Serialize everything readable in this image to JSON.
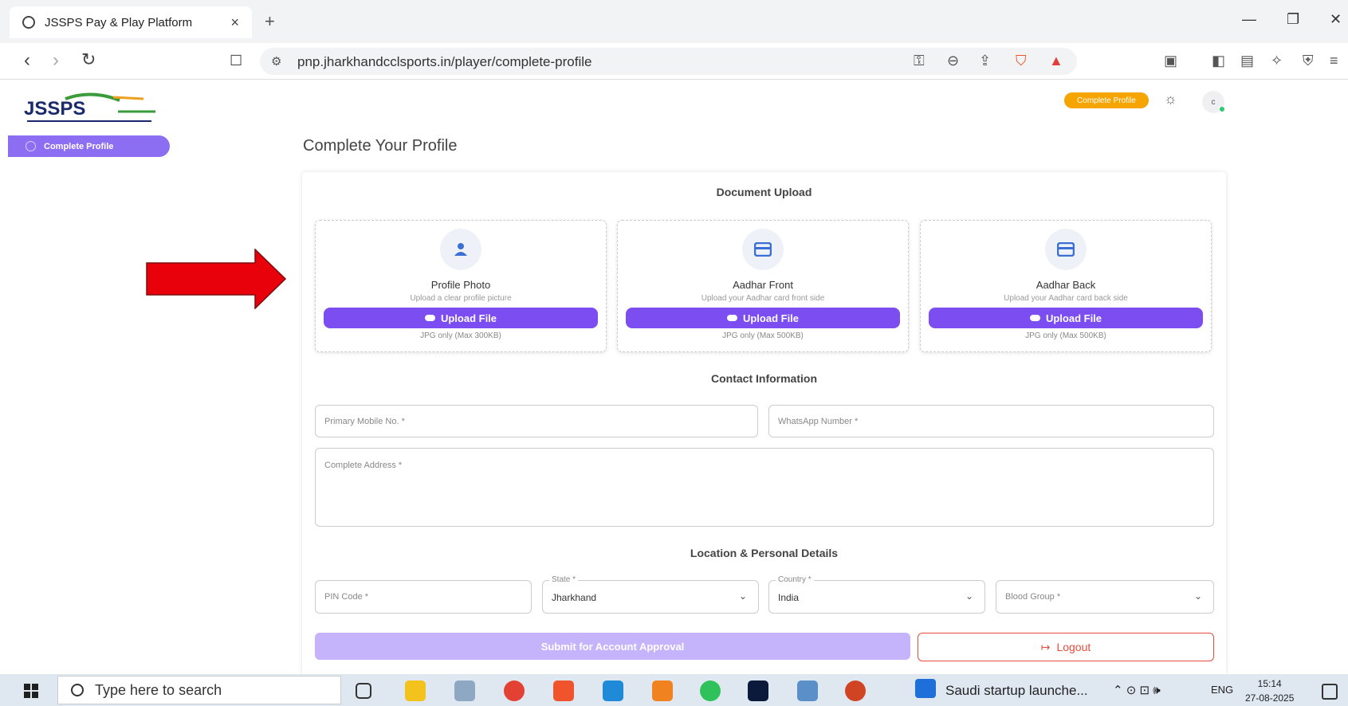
{
  "browser": {
    "tab_title": "JSSPS Pay & Play Platform",
    "url": "pnp.jharkhandcclsports.in/player/complete-profile"
  },
  "sidebar": {
    "logo_text": "JSSPS",
    "items": [
      {
        "label": "Complete Profile"
      }
    ]
  },
  "header": {
    "badge": "Complete Profile",
    "avatar_initial": "c"
  },
  "main": {
    "title": "Complete Your Profile",
    "document_upload": {
      "heading": "Document Upload",
      "cards": [
        {
          "title": "Profile Photo",
          "desc": "Upload a clear profile picture",
          "button": "Upload File",
          "note": "JPG only (Max 300KB)",
          "icon": "person-icon"
        },
        {
          "title": "Aadhar Front",
          "desc": "Upload your Aadhar card front side",
          "button": "Upload File",
          "note": "JPG only (Max 500KB)",
          "icon": "id-card-icon"
        },
        {
          "title": "Aadhar Back",
          "desc": "Upload your Aadhar card back side",
          "button": "Upload File",
          "note": "JPG only (Max 500KB)",
          "icon": "id-card-icon"
        }
      ]
    },
    "contact": {
      "heading": "Contact Information",
      "primary_mobile_placeholder": "Primary Mobile No. *",
      "whatsapp_placeholder": "WhatsApp Number *",
      "address_placeholder": "Complete Address *"
    },
    "location": {
      "heading": "Location & Personal Details",
      "pin_placeholder": "PIN Code *",
      "state_label": "State *",
      "state_value": "Jharkhand",
      "country_label": "Country *",
      "country_value": "India",
      "blood_group_placeholder": "Blood Group *"
    },
    "actions": {
      "submit": "Submit for Account Approval",
      "logout": "Logout"
    }
  },
  "taskbar": {
    "search_placeholder": "Type here to search",
    "notification": "Saudi startup launche...",
    "language": "ENG",
    "time": "15:14",
    "date": "27-08-2025"
  },
  "colors": {
    "accent": "#7c4df0",
    "accent_light": "#c5b3fb",
    "badge": "#f6a400",
    "logout": "#e74c3c",
    "annotation_arrow": "#e8000b"
  }
}
